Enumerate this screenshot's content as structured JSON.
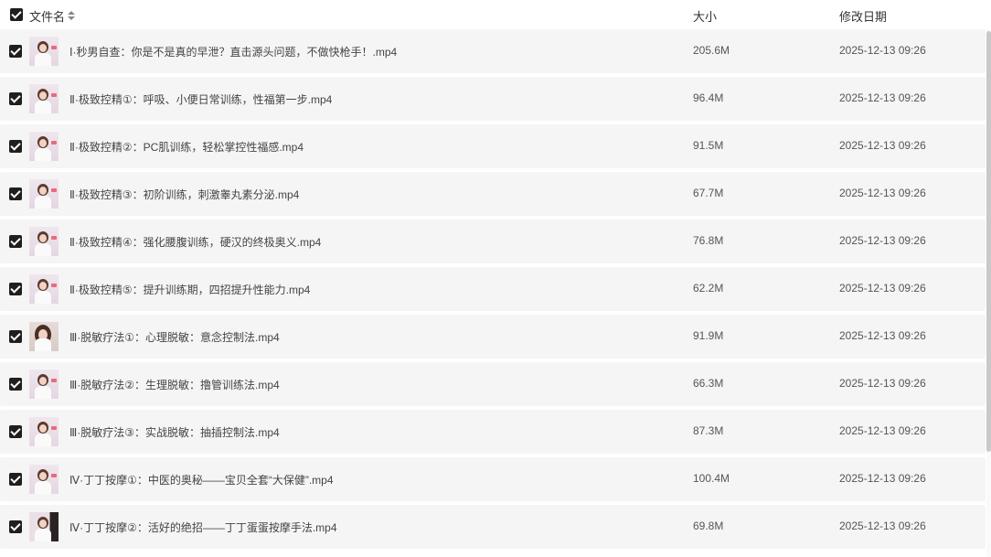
{
  "header": {
    "name_label": "文件名",
    "size_label": "大小",
    "date_label": "修改日期"
  },
  "files": [
    {
      "name": "Ⅰ·秒男自查：你是不是真的早泄？直击源头问题，不做快枪手！.mp4",
      "size": "205.6M",
      "date": "2025-12-13 09:26"
    },
    {
      "name": "Ⅱ·极致控精①：呼吸、小便日常训练，性福第一步.mp4",
      "size": "96.4M",
      "date": "2025-12-13 09:26"
    },
    {
      "name": "Ⅱ·极致控精②：PC肌训练，轻松掌控性福感.mp4",
      "size": "91.5M",
      "date": "2025-12-13 09:26"
    },
    {
      "name": "Ⅱ·极致控精③：初阶训练，刺激睾丸素分泌.mp4",
      "size": "67.7M",
      "date": "2025-12-13 09:26"
    },
    {
      "name": "Ⅱ·极致控精④：强化腰腹训练，硬汉的终极奥义.mp4",
      "size": "76.8M",
      "date": "2025-12-13 09:26"
    },
    {
      "name": "Ⅱ·极致控精⑤：提升训练期，四招提升性能力.mp4",
      "size": "62.2M",
      "date": "2025-12-13 09:26"
    },
    {
      "name": "Ⅲ·脱敏疗法①：心理脱敏：意念控制法.mp4",
      "size": "91.9M",
      "date": "2025-12-13 09:26"
    },
    {
      "name": "Ⅲ·脱敏疗法②：生理脱敏：撸管训练法.mp4",
      "size": "66.3M",
      "date": "2025-12-13 09:26"
    },
    {
      "name": "Ⅲ·脱敏疗法③：实战脱敏：抽插控制法.mp4",
      "size": "87.3M",
      "date": "2025-12-13 09:26"
    },
    {
      "name": "Ⅳ·丁丁按摩①：中医的奥秘——宝贝全套“大保健”.mp4",
      "size": "100.4M",
      "date": "2025-12-13 09:26"
    },
    {
      "name": "Ⅳ·丁丁按摩②：活好的绝招——丁丁蛋蛋按摩手法.mp4",
      "size": "69.8M",
      "date": "2025-12-13 09:26"
    }
  ]
}
